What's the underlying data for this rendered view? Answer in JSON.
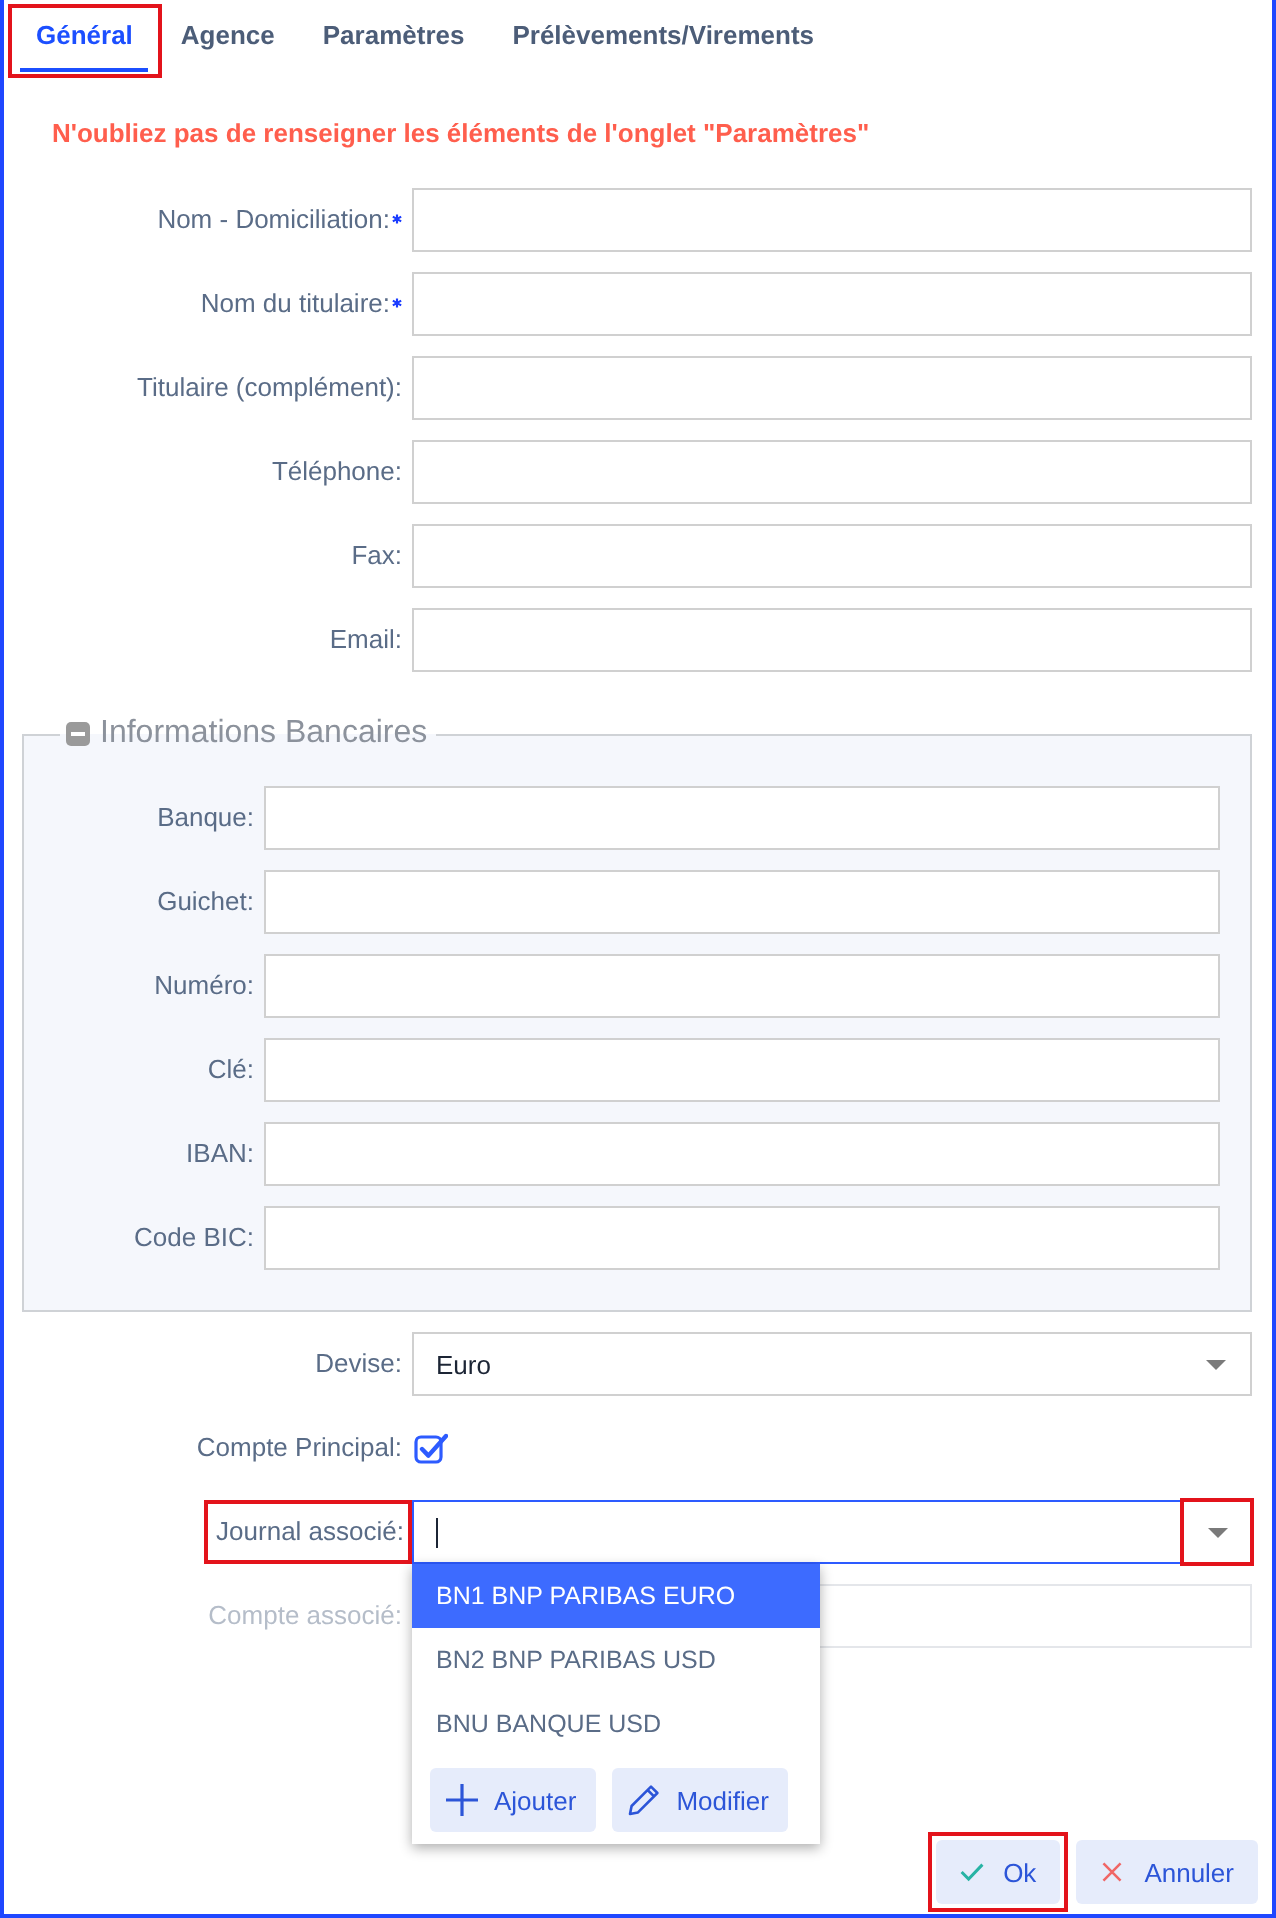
{
  "tabs": [
    {
      "label": "Général",
      "selected": true,
      "highlighted": true
    },
    {
      "label": "Agence",
      "selected": false,
      "highlighted": false
    },
    {
      "label": "Paramètres",
      "selected": false,
      "highlighted": false
    },
    {
      "label": "Prélèvements/Virements",
      "selected": false,
      "highlighted": false
    }
  ],
  "warning": "N'oubliez pas de renseigner les éléments de l'onglet \"Paramètres\"",
  "fields": [
    {
      "label": "Nom - Domiciliation:",
      "required": true
    },
    {
      "label": "Nom du titulaire:",
      "required": true
    },
    {
      "label": "Titulaire (complément):",
      "required": false
    },
    {
      "label": "Téléphone:",
      "required": false
    },
    {
      "label": "Fax:",
      "required": false
    },
    {
      "label": "Email:",
      "required": false
    }
  ],
  "bank_section": {
    "title": "Informations Bancaires",
    "expanded": true,
    "fields": [
      {
        "label": "Banque:"
      },
      {
        "label": "Guichet:"
      },
      {
        "label": "Numéro:"
      },
      {
        "label": "Clé:"
      },
      {
        "label": "IBAN:"
      },
      {
        "label": "Code BIC:"
      }
    ]
  },
  "lower_fields": [
    {
      "kind": "select",
      "label": "Devise:",
      "value": "Euro",
      "label_highlighted": false,
      "caret_highlighted": false
    },
    {
      "kind": "checkbox",
      "label": "Compte Principal:",
      "checked": true,
      "label_highlighted": false
    },
    {
      "kind": "combobox",
      "label": "Journal associé:",
      "focused": true,
      "label_highlighted": true,
      "caret_highlighted": true,
      "dropdown": {
        "options": [
          {
            "label": "BN1 BNP PARIBAS EURO",
            "selected": true
          },
          {
            "label": "BN2 BNP PARIBAS USD",
            "selected": false
          },
          {
            "label": "BNU BANQUE USD",
            "selected": false
          }
        ],
        "actions": [
          {
            "kind": "add",
            "label": "Ajouter"
          },
          {
            "kind": "edit",
            "label": "Modifier"
          }
        ]
      }
    },
    {
      "kind": "text",
      "label": "Compte associé:",
      "disabled": true,
      "label_highlighted": false
    }
  ],
  "buttons": [
    {
      "kind": "ok",
      "label": "Ok",
      "highlighted": true
    },
    {
      "kind": "cancel",
      "label": "Annuler",
      "highlighted": false
    }
  ]
}
